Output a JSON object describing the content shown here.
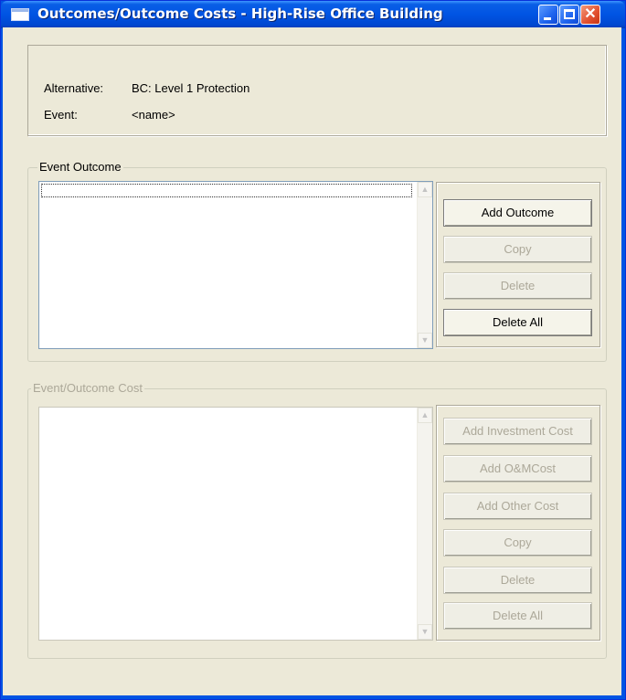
{
  "window": {
    "title": "Outcomes/Outcome Costs - High-Rise Office Building",
    "minimize_label": "_",
    "maximize_label": "□",
    "close_label": "✕"
  },
  "info": {
    "alternative_label": "Alternative:",
    "alternative_value": "BC: Level 1 Protection",
    "event_label": "Event:",
    "event_value": "<name>"
  },
  "event_outcome": {
    "title": "Event Outcome",
    "buttons": [
      "Add Outcome",
      "Copy",
      "Delete",
      "Delete All"
    ]
  },
  "event_outcome_cost": {
    "title": "Event/Outcome Cost",
    "buttons": [
      "Add Investment Cost",
      "Add O&MCost",
      "Add Other Cost",
      "Copy",
      "Delete",
      "Delete All"
    ]
  },
  "scroll_icons": {
    "up": "▲",
    "down": "▼"
  }
}
